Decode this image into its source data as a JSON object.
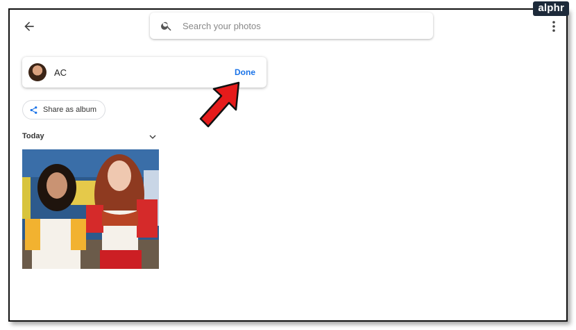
{
  "watermark": {
    "text": "alphr"
  },
  "header": {
    "back_icon": "arrow-left-icon",
    "more_icon": "more-vertical-icon"
  },
  "search": {
    "placeholder": "Search your photos",
    "icon": "search-icon"
  },
  "name_editor": {
    "value": "AC",
    "done_label": "Done"
  },
  "share": {
    "label": "Share as album",
    "icon": "share-icon"
  },
  "section": {
    "title": "Today",
    "toggle_icon": "chevron-down-icon"
  },
  "colors": {
    "accent": "#1a73e8",
    "annotation_arrow": "#e51b1b"
  }
}
